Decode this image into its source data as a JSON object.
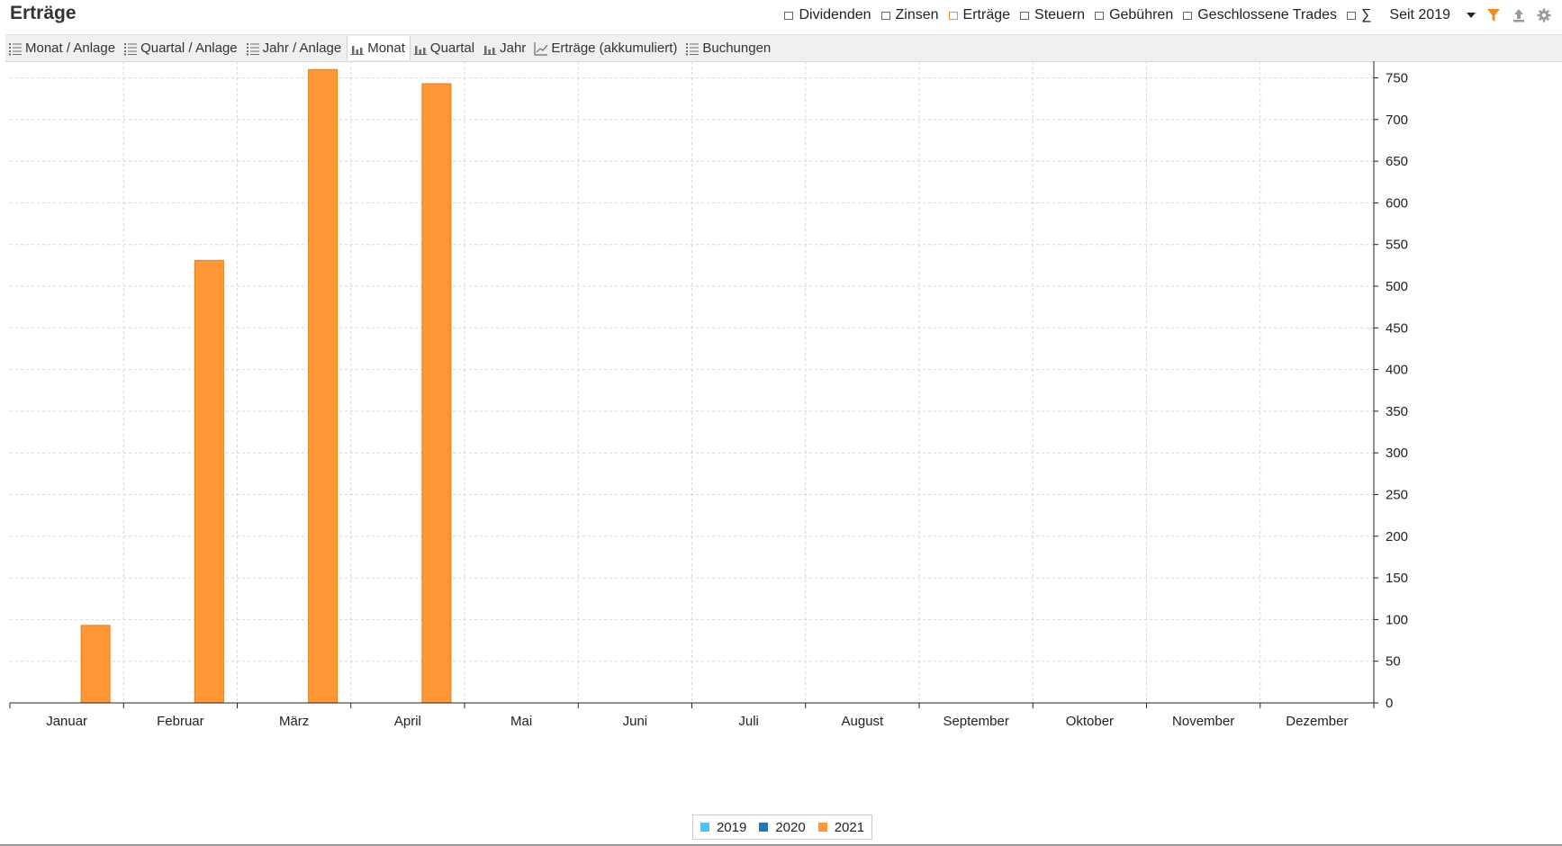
{
  "header": {
    "title": "Erträge",
    "filters": [
      {
        "label": "Dividenden",
        "checked": false
      },
      {
        "label": "Zinsen",
        "checked": false
      },
      {
        "label": "Erträge",
        "checked": false,
        "accent": "#f28c28"
      },
      {
        "label": "Steuern",
        "checked": false
      },
      {
        "label": "Gebühren",
        "checked": false
      },
      {
        "label": "Geschlossene Trades",
        "checked": false
      },
      {
        "label": "∑",
        "checked": false
      }
    ],
    "year_select": "Seit 2019",
    "icons": [
      "filter-icon",
      "export-icon",
      "gear-icon"
    ],
    "filter_icon_color": "#f28c28"
  },
  "tabs": [
    {
      "label": "Monat / Anlage",
      "icon": "list-icon"
    },
    {
      "label": "Quartal / Anlage",
      "icon": "list-icon"
    },
    {
      "label": "Jahr / Anlage",
      "icon": "list-icon"
    },
    {
      "label": "Monat",
      "icon": "bar-chart-icon",
      "active": true
    },
    {
      "label": "Quartal",
      "icon": "bar-chart-icon"
    },
    {
      "label": "Jahr",
      "icon": "bar-chart-icon"
    },
    {
      "label": "Erträge (akkumuliert)",
      "icon": "line-chart-icon"
    },
    {
      "label": "Buchungen",
      "icon": "list-icon"
    }
  ],
  "chart_data": {
    "type": "bar",
    "categories": [
      "Januar",
      "Februar",
      "März",
      "April",
      "Mai",
      "Juni",
      "Juli",
      "August",
      "September",
      "Oktober",
      "November",
      "Dezember"
    ],
    "series": [
      {
        "name": "2019",
        "color": "#4fc3f7",
        "values": [
          0,
          0,
          0,
          0,
          0,
          0,
          0,
          0,
          0,
          0,
          0,
          0
        ]
      },
      {
        "name": "2020",
        "color": "#1f77b4",
        "values": [
          0,
          0,
          0,
          0,
          0,
          0,
          0,
          0,
          0,
          0,
          0,
          0
        ]
      },
      {
        "name": "2021",
        "color": "#ff9736",
        "values": [
          93,
          531,
          760,
          743,
          0,
          0,
          0,
          0,
          0,
          0,
          0,
          0
        ]
      }
    ],
    "ylim": [
      0,
      770
    ],
    "yticks": [
      0,
      50,
      100,
      150,
      200,
      250,
      300,
      350,
      400,
      450,
      500,
      550,
      600,
      650,
      700,
      750
    ],
    "grid": true,
    "y_axis_side": "right",
    "legend_position": "bottom-center"
  }
}
